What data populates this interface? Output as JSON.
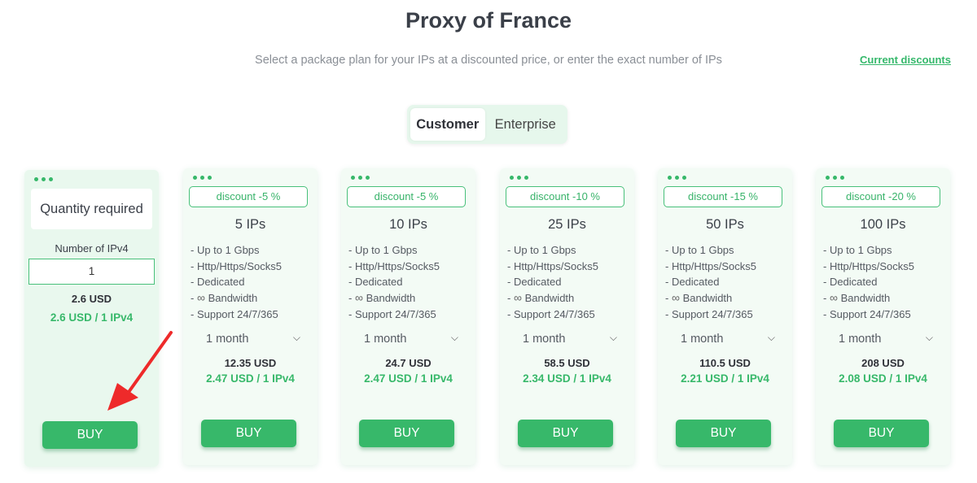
{
  "header": {
    "title": "Proxy of France",
    "subtitle": "Select a package plan for your IPs at a discounted price, or enter the exact number of IPs",
    "discounts_link": "Current discounts"
  },
  "toggle": {
    "options": [
      "Customer",
      "Enterprise"
    ],
    "selected": "Customer"
  },
  "custom_card": {
    "quantity_label": "Quantity required",
    "number_label": "Number of IPv4",
    "quantity_value": "1",
    "total": "2.6 USD",
    "per_ip": "2.6 USD / 1 IPv4",
    "buy_label": "BUY"
  },
  "features": [
    "- Up to 1 Gbps",
    "- Http/Https/Socks5",
    "- Dedicated",
    "Bandwidth",
    "- Support 24/7/365"
  ],
  "infinity_symbol": "∞",
  "plans": [
    {
      "discount": "discount -5 %",
      "ips": "5 IPs",
      "period": "1 month",
      "total": "12.35 USD",
      "per_ip": "2.47 USD / 1 IPv4",
      "buy_label": "BUY"
    },
    {
      "discount": "discount -5 %",
      "ips": "10 IPs",
      "period": "1 month",
      "total": "24.7 USD",
      "per_ip": "2.47 USD / 1 IPv4",
      "buy_label": "BUY"
    },
    {
      "discount": "discount -10 %",
      "ips": "25 IPs",
      "period": "1 month",
      "total": "58.5 USD",
      "per_ip": "2.34 USD / 1 IPv4",
      "buy_label": "BUY"
    },
    {
      "discount": "discount -15 %",
      "ips": "50 IPs",
      "period": "1 month",
      "total": "110.5 USD",
      "per_ip": "2.21 USD / 1 IPv4",
      "buy_label": "BUY"
    },
    {
      "discount": "discount -20 %",
      "ips": "100 IPs",
      "period": "1 month",
      "total": "208 USD",
      "per_ip": "2.08 USD / 1 IPv4",
      "buy_label": "BUY"
    }
  ],
  "colors": {
    "accent": "#37b86a",
    "card_bg": "#f3fbf5",
    "annotation_arrow": "#ee2a2a"
  },
  "icons": {
    "dots": "three-dots-icon",
    "chevron": "chevron-down-icon",
    "infinity": "infinity-icon",
    "annotation": "red-arrow-annotation"
  }
}
